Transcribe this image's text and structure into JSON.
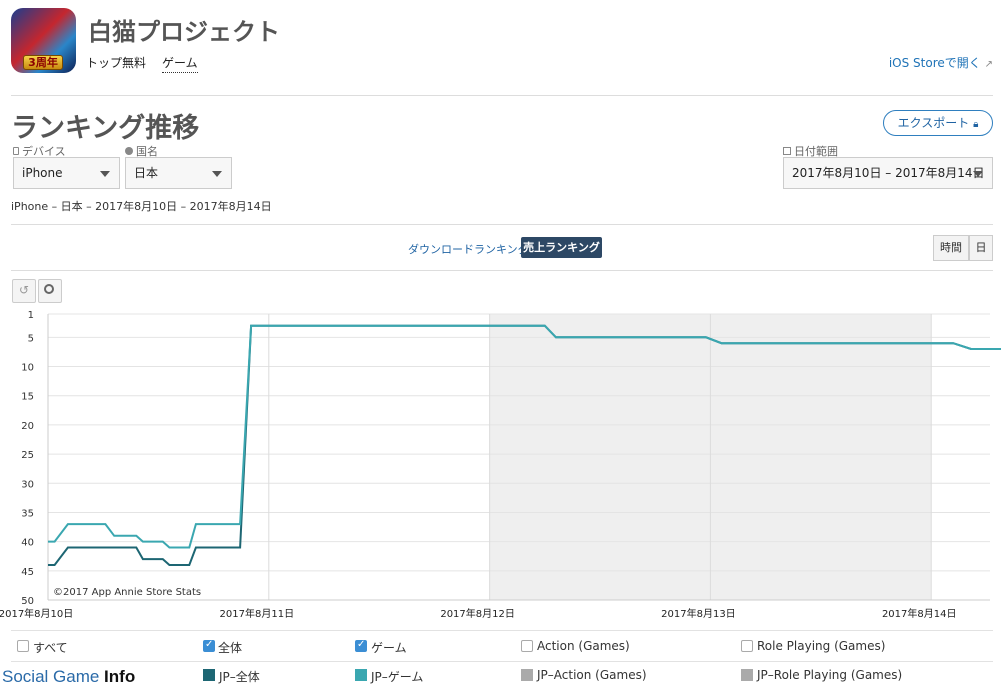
{
  "app": {
    "title": "白猫プロジェクト",
    "icon_badge": "3周年",
    "breadcrumb": [
      "トップ無料",
      "ゲーム"
    ],
    "ios_link": "iOS Storeで開く"
  },
  "page": {
    "heading": "ランキング推移",
    "export_label": "エクスポート",
    "filters": {
      "device_label": "デバイス",
      "device_value": "iPhone",
      "country_label": "国名",
      "country_value": "日本",
      "date_label": "日付範囲",
      "date_value": "2017年8月10日 – 2017年8月14日"
    },
    "summary": "iPhone – 日本 – 2017年8月10日 – 2017年8月14日",
    "tabs": {
      "download": "ダウンロードランキング",
      "sales": "売上ランキング"
    },
    "granularity": [
      "時間",
      "日"
    ]
  },
  "chart_data": {
    "type": "line",
    "y_reversed": true,
    "ylim": [
      1,
      50
    ],
    "y_ticks": [
      1,
      5,
      10,
      15,
      20,
      25,
      30,
      35,
      40,
      45,
      50
    ],
    "x_ticks": [
      "2017年8月10日",
      "2017年8月11日",
      "2017年8月12日",
      "2017年8月13日",
      "2017年8月14日"
    ],
    "xlim": [
      0,
      4
    ],
    "shaded_ranges": [
      [
        2,
        3
      ],
      [
        3,
        4
      ]
    ],
    "watermark": "©2017 App Annie Store Stats",
    "series": [
      {
        "name": "JP-全体",
        "color": "#1d6673",
        "points": [
          [
            0,
            44
          ],
          [
            0.03,
            44
          ],
          [
            0.09,
            41
          ],
          [
            0.4,
            41
          ],
          [
            0.43,
            43
          ],
          [
            0.52,
            43
          ],
          [
            0.55,
            44
          ],
          [
            0.64,
            44
          ],
          [
            0.67,
            41
          ],
          [
            0.87,
            41
          ],
          [
            0.92,
            3
          ],
          [
            2.25,
            3
          ],
          [
            2.3,
            5
          ],
          [
            2.98,
            5
          ],
          [
            3.05,
            6
          ],
          [
            4.1,
            6
          ],
          [
            4.18,
            7
          ],
          [
            4.45,
            7
          ]
        ]
      },
      {
        "name": "JP-ゲーム",
        "color": "#3aa7b0",
        "points": [
          [
            0,
            40
          ],
          [
            0.03,
            40
          ],
          [
            0.09,
            37
          ],
          [
            0.26,
            37
          ],
          [
            0.3,
            39
          ],
          [
            0.4,
            39
          ],
          [
            0.43,
            40
          ],
          [
            0.52,
            40
          ],
          [
            0.55,
            41
          ],
          [
            0.64,
            41
          ],
          [
            0.67,
            37
          ],
          [
            0.87,
            37
          ],
          [
            0.92,
            3
          ],
          [
            2.25,
            3
          ],
          [
            2.3,
            5
          ],
          [
            2.98,
            5
          ],
          [
            3.05,
            6
          ],
          [
            4.1,
            6
          ],
          [
            4.18,
            7
          ],
          [
            4.45,
            7
          ]
        ]
      }
    ]
  },
  "legend": {
    "checkboxes": [
      {
        "label": "すべて",
        "checked": false
      },
      {
        "label": "全体",
        "checked": true
      },
      {
        "label": "ゲーム",
        "checked": true
      },
      {
        "label": "Action (Games)",
        "checked": false
      },
      {
        "label": "Role Playing (Games)",
        "checked": false
      }
    ],
    "series": [
      {
        "label": "JP–全体",
        "color": "#1d6673"
      },
      {
        "label": "JP–ゲーム",
        "color": "#3aa7b0"
      },
      {
        "label": "JP–Action (Games)",
        "color": "#aaaaaa"
      },
      {
        "label": "JP–Role Playing (Games)",
        "color": "#aaaaaa"
      }
    ]
  },
  "watermark_brand": {
    "part1": "Social Game ",
    "part2": "Info"
  }
}
